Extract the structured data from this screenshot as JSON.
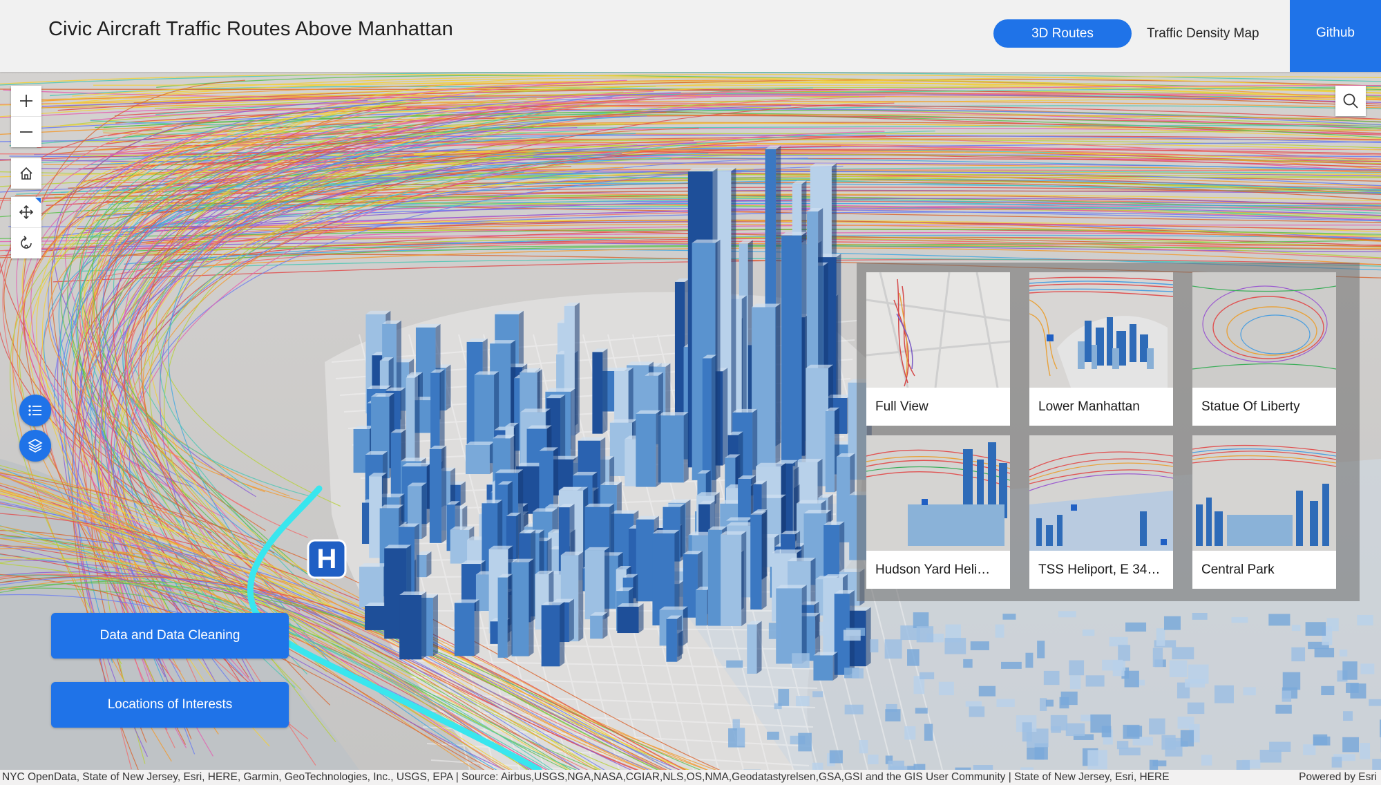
{
  "header": {
    "title": "Civic Aircraft Traffic Routes Above Manhattan",
    "tabs": [
      {
        "label": "3D Routes",
        "active": true
      },
      {
        "label": "Traffic Density Map",
        "active": false
      }
    ],
    "github_label": "Github"
  },
  "colors": {
    "accent": "#1f73e8",
    "header_bg": "#f1f1f1",
    "route_highlight": "#39e6ee",
    "building_dark": "#1e4f99",
    "building_light": "#8ab2d8"
  },
  "map": {
    "controls": {
      "zoom_in": "plus-icon",
      "zoom_out": "minus-icon",
      "home": "home-icon",
      "pan": "move-icon",
      "rotate": "rotate-icon",
      "search": "search-icon",
      "legend": "list-icon",
      "layers": "layers-icon"
    },
    "heliport_marker": "H"
  },
  "buttons": {
    "data_cleaning": "Data and Data Cleaning",
    "locations": "Locations of Interests"
  },
  "slides": [
    {
      "label": "Full View"
    },
    {
      "label": "Lower Manhattan"
    },
    {
      "label": "Statue Of Liberty"
    },
    {
      "label": "Hudson Yard Heli…"
    },
    {
      "label": "TSS Heliport, E 34…"
    },
    {
      "label": "Central Park"
    }
  ],
  "attribution": {
    "text": "NYC OpenData, State of New Jersey, Esri, HERE, Garmin, GeoTechnologies, Inc., USGS, EPA | Source: Airbus,USGS,NGA,NASA,CGIAR,NLS,OS,NMA,Geodatastyrelsen,GSA,GSI and the GIS User Community | State of New Jersey, Esri, HERE",
    "powered": "Powered by Esri"
  }
}
